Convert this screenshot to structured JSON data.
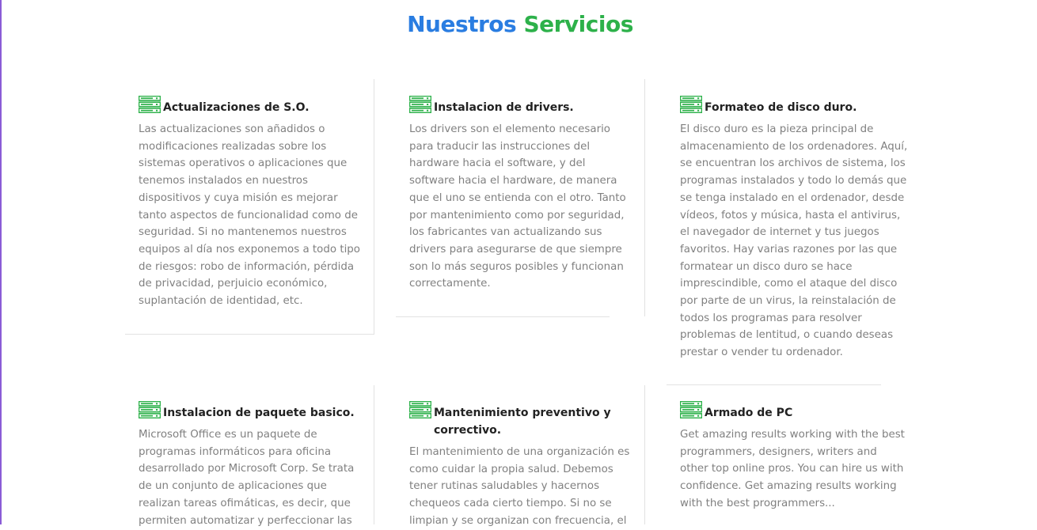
{
  "section": {
    "title_part1": "Nuestros",
    "title_part2": "Servicios"
  },
  "colors": {
    "title_blue": "#2a7de1",
    "title_green": "#2db14a",
    "icon_green": "#2db14a",
    "card_title": "#222222",
    "card_text": "#808080"
  },
  "services": [
    {
      "icon": "server-icon",
      "title": "Actualizaciones de S.O.",
      "text": "Las actualizaciones son añadidos o modificaciones realizadas sobre los sistemas operativos o aplicaciones que tenemos instalados en nuestros dispositivos y cuya misión es mejorar tanto aspectos de funcionalidad como de seguridad. Si no mantenemos nuestros equipos al día nos exponemos a todo tipo de riesgos: robo de información, pérdida de privacidad, perjuicio económico, suplantación de identidad, etc."
    },
    {
      "icon": "server-icon",
      "title": "Instalacion de drivers.",
      "text": "Los drivers son el elemento necesario para traducir las instrucciones del hardware hacia el software, y del software hacia el hardware, de manera que el uno se entienda con el otro. Tanto por mantenimiento como por seguridad, los fabricantes van actualizando sus drivers para asegurarse de que siempre son lo más seguros posibles y funcionan correctamente."
    },
    {
      "icon": "server-icon",
      "title": "Formateo de disco duro.",
      "text": "El disco duro es la pieza principal de almacenamiento de los ordenadores. Aquí, se encuentran los archivos de sistema, los programas instalados y todo lo demás que se tenga instalado en el ordenador, desde vídeos, fotos y música, hasta el antivirus, el navegador de internet y tus juegos favoritos. Hay varias razones por las que formatear un disco duro se hace imprescindible, como el ataque del disco por parte de un virus, la reinstalación de todos los programas para resolver problemas de lentitud, o cuando deseas prestar o vender tu ordenador."
    },
    {
      "icon": "server-icon",
      "title": "Instalacion de paquete basico.",
      "text": "Microsoft Office es un paquete de programas informáticos para oficina desarrollado por Microsoft Corp. Se trata de un conjunto de aplicaciones que realizan tareas ofimáticas, es decir, que permiten automatizar y perfeccionar las"
    },
    {
      "icon": "server-icon",
      "title": "Mantenimiento preventivo y correctivo.",
      "text": "El mantenimiento de una organización es como cuidar la propia salud. Debemos tener rutinas saludables y hacernos chequeos cada cierto tiempo. Si no se limpian y se organizan con frecuencia, el"
    },
    {
      "icon": "server-icon",
      "title": "Armado de PC",
      "text": "Get amazing results working with the best programmers, designers, writers and other top online pros. You can hire us with confidence. Get amazing results working with the best programmers..."
    }
  ]
}
